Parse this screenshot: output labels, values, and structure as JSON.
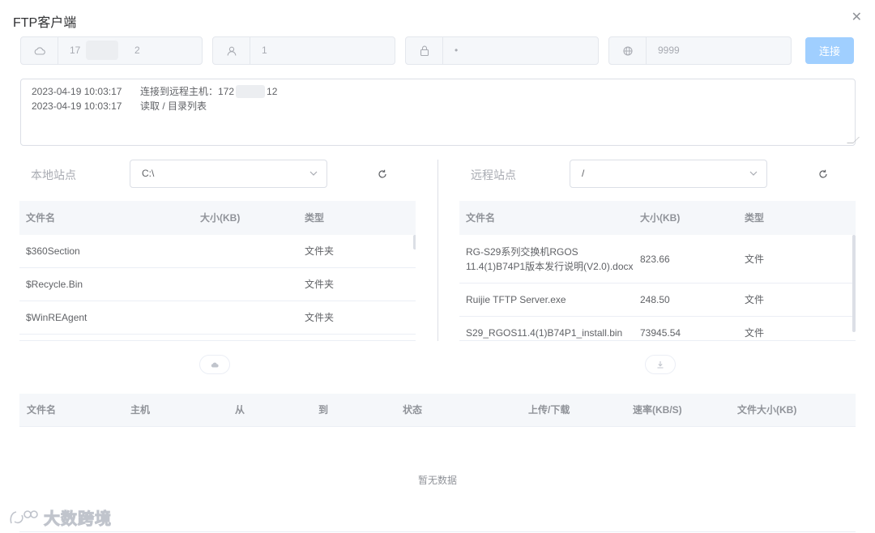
{
  "dialog": {
    "title": "FTP客户端"
  },
  "connection": {
    "host_prefix": "17",
    "host_suffix": "2",
    "username": "1",
    "password_mask": "•",
    "port": "9999",
    "connect_label": "连接"
  },
  "log": [
    {
      "time": "2023-04-19 10:03:17",
      "message": "连接到远程主机：172",
      "suffix": "12"
    },
    {
      "time": "2023-04-19 10:03:17",
      "message": "读取 / 目录列表",
      "suffix": ""
    }
  ],
  "local": {
    "label": "本地站点",
    "path": "C:\\",
    "columns": [
      "文件名",
      "大小(KB)",
      "类型"
    ],
    "rows": [
      {
        "name": "$360Section",
        "size": "",
        "type": "文件夹"
      },
      {
        "name": "$Recycle.Bin",
        "size": "",
        "type": "文件夹"
      },
      {
        "name": "$WinREAgent",
        "size": "",
        "type": "文件夹"
      }
    ]
  },
  "remote": {
    "label": "远程站点",
    "path": "/",
    "columns": [
      "文件名",
      "大小(KB)",
      "类型"
    ],
    "rows": [
      {
        "name": "RG-S29系列交换机RGOS 11.4(1)B74P1版本发行说明(V2.0).docx",
        "size": "823.66",
        "type": "文件"
      },
      {
        "name": "Ruijie TFTP Server.exe",
        "size": "248.50",
        "type": "文件"
      },
      {
        "name": "S29_RGOS11.4(1)B74P1_install.bin",
        "size": "73945.54",
        "type": "文件"
      }
    ]
  },
  "transfers": {
    "columns": [
      "文件名",
      "主机",
      "从",
      "到",
      "状态",
      "上传/下载",
      "速率(KB/S)",
      "文件大小(KB)"
    ],
    "empty_text": "暂无数据"
  },
  "watermark": {
    "text": "大数跨境"
  },
  "colors": {
    "primary_disabled": "#a0cfff",
    "header_bg": "#f5f7fa",
    "border": "#dcdfe6"
  }
}
